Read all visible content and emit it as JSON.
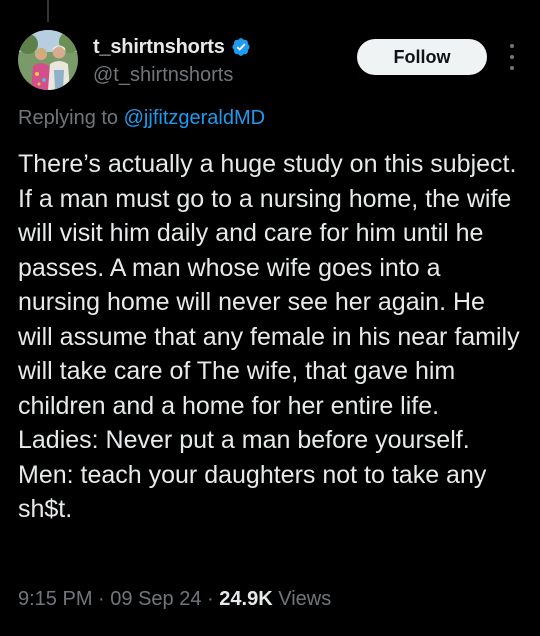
{
  "user": {
    "display_name": "t_shirtnshorts",
    "handle": "@t_shirtnshorts",
    "verified_icon": "verified-badge-icon",
    "avatar_icon": "profile-photo"
  },
  "follow_label": "Follow",
  "more_icon": "more-vertical-icon",
  "reply": {
    "prefix": "Replying to",
    "mention": "@jjfitzgeraldMD"
  },
  "tweet_text": "There’s actually a huge study on this subject. If a man must go to a nursing home, the wife will visit him daily and care for him until he passes. A man whose wife goes into a nursing home will never see her again. He will assume that any female in his near family will take care of The wife, that gave him children and a home for her entire life. Ladies: Never put a man before yourself. Men: teach your daughters not to take any sh$t.",
  "meta": {
    "time": "9:15 PM",
    "separator": "·",
    "date": "09 Sep 24",
    "views_count": "24.9K",
    "views_label": "Views"
  },
  "colors": {
    "background": "#000000",
    "text": "#e7e9ea",
    "muted": "#71767b",
    "link": "#1d9bf0",
    "follow_bg": "#eff3f4"
  }
}
